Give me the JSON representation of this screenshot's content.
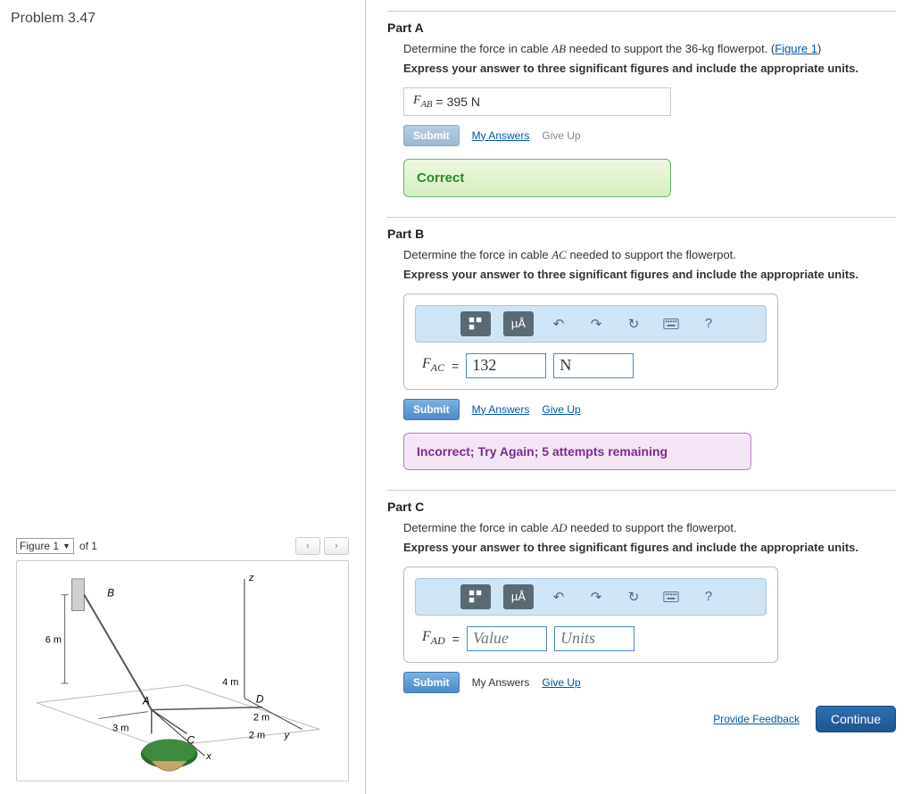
{
  "problem_title": "Problem 3.47",
  "figure_nav": {
    "select_label": "Figure 1",
    "of_text": "of 1",
    "prev": "‹",
    "next": "›"
  },
  "figure": {
    "labels": {
      "z": "z",
      "y": "y",
      "x": "x",
      "B": "B",
      "A": "A",
      "C": "C",
      "D": "D"
    },
    "dims": {
      "d6m": "6 m",
      "d3m": "3 m",
      "d4m": "4 m",
      "d2m_a": "2 m",
      "d2m_b": "2 m"
    }
  },
  "part_a": {
    "title": "Part A",
    "prompt_pre": "Determine the force in cable ",
    "cable": "AB",
    "prompt_post": " needed to support the 36-kg flowerpot. (",
    "figlink": "Figure 1",
    "prompt_close": ")",
    "instruction": "Express your answer to three significant figures and include the appropriate units.",
    "var_base": "F",
    "var_sub": "AB",
    "eq": "=",
    "value": "395 N",
    "submit": "Submit",
    "my_answers": "My Answers",
    "give_up": "Give Up",
    "feedback": "Correct"
  },
  "part_b": {
    "title": "Part B",
    "prompt_pre": "Determine the force in cable ",
    "cable": "AC",
    "prompt_post": " needed to support the flowerpot.",
    "instruction": "Express your answer to three significant figures and include the appropriate units.",
    "var_base": "F",
    "var_sub": "AC",
    "eq": "=",
    "value": "132",
    "units": "N",
    "submit": "Submit",
    "my_answers": "My Answers",
    "give_up": "Give Up",
    "feedback": "Incorrect; Try Again; 5 attempts remaining",
    "mu_label": "µÅ"
  },
  "part_c": {
    "title": "Part C",
    "prompt_pre": "Determine the force in cable ",
    "cable": "AD",
    "prompt_post": " needed to support the flowerpot.",
    "instruction": "Express your answer to three significant figures and include the appropriate units.",
    "var_base": "F",
    "var_sub": "AD",
    "eq": "=",
    "value_ph": "Value",
    "units_ph": "Units",
    "submit": "Submit",
    "my_answers": "My Answers",
    "give_up": "Give Up",
    "mu_label": "µÅ"
  },
  "footer": {
    "feedback": "Provide Feedback",
    "continue": "Continue"
  }
}
